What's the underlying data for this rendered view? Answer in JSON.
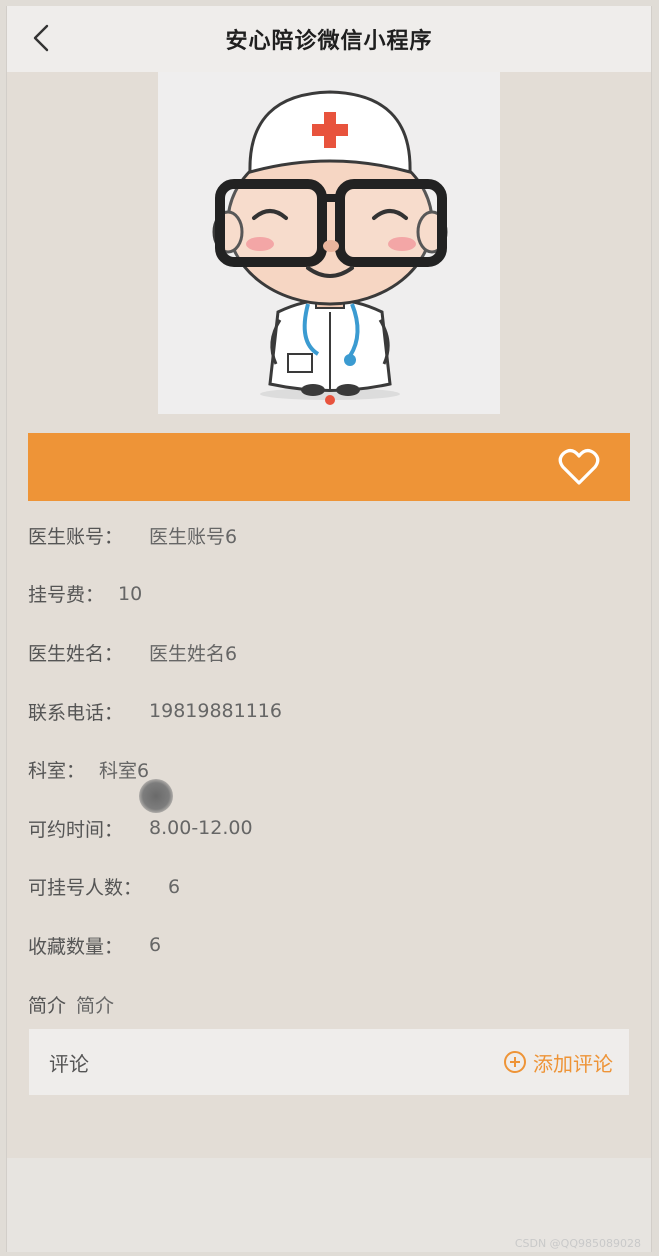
{
  "header": {
    "title": "安心陪诊微信小程序",
    "back_icon": "chevron-left-icon"
  },
  "doctor_image": {
    "icon": "doctor-cartoon"
  },
  "banner": {
    "color": "#ee9437",
    "favorite_icon": "heart-outline-icon"
  },
  "info": {
    "rows": [
      {
        "label": "医生账号：",
        "value": "医生账号6"
      },
      {
        "label": "挂号费：",
        "value": "10"
      },
      {
        "label": "医生姓名：",
        "value": "医生姓名6"
      },
      {
        "label": "联系电话：",
        "value": "19819881116"
      },
      {
        "label": "科室：",
        "value": "科室6"
      },
      {
        "label": "可约时间：",
        "value": "8.00-12.00"
      },
      {
        "label": "可挂号人数：",
        "value": "6"
      },
      {
        "label": "收藏数量：",
        "value": "6"
      },
      {
        "label": "简介",
        "value": "简介"
      }
    ]
  },
  "comments": {
    "title": "评论",
    "add_label": "添加评论",
    "add_icon": "plus-circle-icon"
  },
  "watermark": "CSDN @QQ985089028",
  "colors": {
    "accent": "#ee9437",
    "background": "#e3ddd6",
    "header_bg": "#efedeb"
  }
}
